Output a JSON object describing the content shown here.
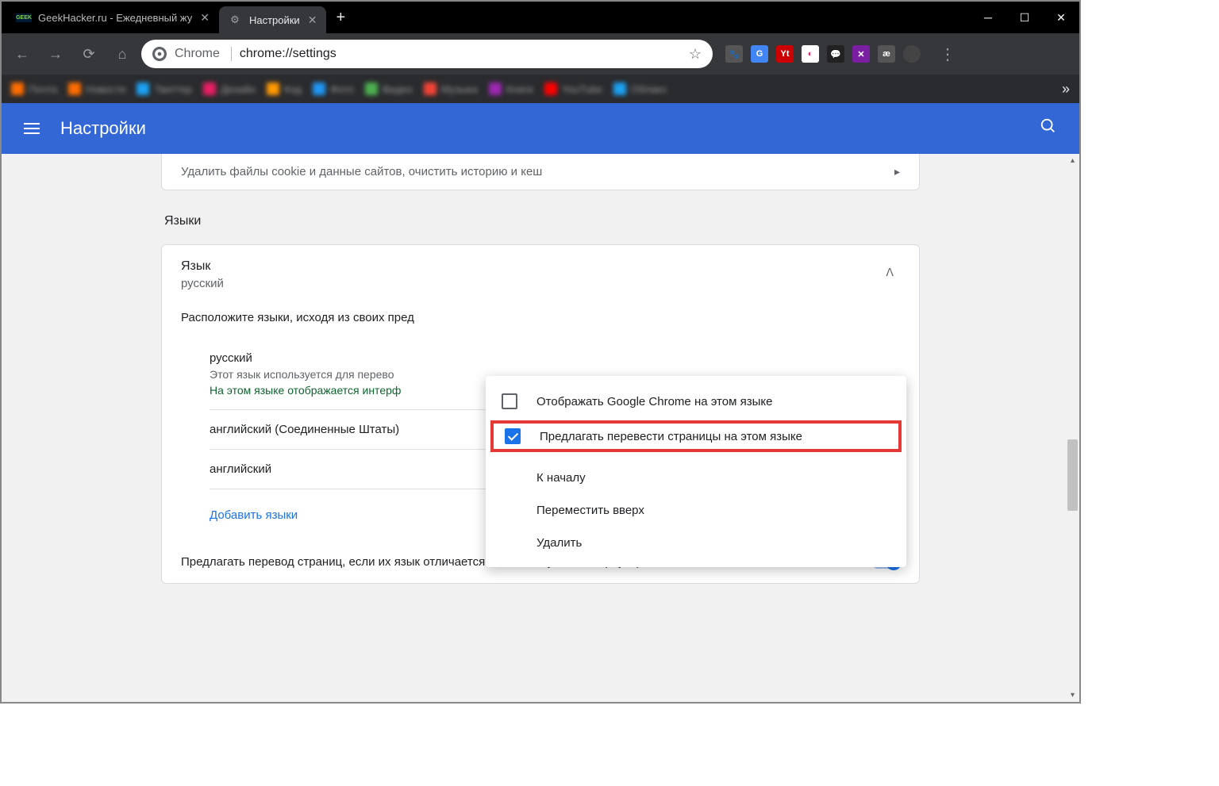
{
  "tabs": [
    {
      "title": "GeekHacker.ru - Ежедневный жу",
      "icon": "GEEK"
    },
    {
      "title": "Настройки",
      "icon": "gear"
    }
  ],
  "omnibox": {
    "label": "Chrome",
    "url": "chrome://settings"
  },
  "extensions": [
    {
      "bg": "#555",
      "txt": ""
    },
    {
      "bg": "#4285f4",
      "txt": "G"
    },
    {
      "bg": "#cc0000",
      "txt": "Yt"
    },
    {
      "bg": "#fff",
      "txt": "◐"
    },
    {
      "bg": "#222",
      "txt": "💬"
    },
    {
      "bg": "#7b1fa2",
      "txt": "✕"
    },
    {
      "bg": "#555",
      "txt": "æ"
    }
  ],
  "bookmarks": [
    {
      "bg": "#ff6d00",
      "txt": "Почта"
    },
    {
      "bg": "#ff6d00",
      "txt": "Новости"
    },
    {
      "bg": "#1da1f2",
      "txt": "Твиттер"
    },
    {
      "bg": "#e91e63",
      "txt": "Дизайн"
    },
    {
      "bg": "#ff9800",
      "txt": "Код"
    },
    {
      "bg": "#2196f3",
      "txt": "Фото"
    },
    {
      "bg": "#4caf50",
      "txt": "Видео"
    },
    {
      "bg": "#f44336",
      "txt": "Музыка"
    },
    {
      "bg": "#9c27b0",
      "txt": "Книги"
    },
    {
      "bg": "#ff0000",
      "txt": "YouTube"
    },
    {
      "bg": "#1da1f2",
      "txt": "Облако"
    }
  ],
  "settings_header": {
    "title": "Настройки"
  },
  "clear_section": {
    "subtitle": "Удалить файлы cookie и данные сайтов, очистить историю и кеш"
  },
  "languages": {
    "section_title": "Языки",
    "label": "Язык",
    "current": "русский",
    "instruction": "Расположите языки, исходя из своих пред",
    "items": [
      {
        "name": "русский",
        "desc1": "Этот язык используется для перево",
        "desc2": "На этом языке отображается интерф"
      },
      {
        "name": "английский (Соединенные Штаты)"
      },
      {
        "name": "английский"
      }
    ],
    "add_label": "Добавить языки",
    "translate_offer": "Предлагать перевод страниц, если их язык отличается от используемого в браузере"
  },
  "context_menu": {
    "display_in_lang": "Отображать Google Chrome на этом языке",
    "offer_translate": "Предлагать перевести страницы на этом языке",
    "to_top": "К началу",
    "move_up": "Переместить вверх",
    "delete": "Удалить"
  }
}
